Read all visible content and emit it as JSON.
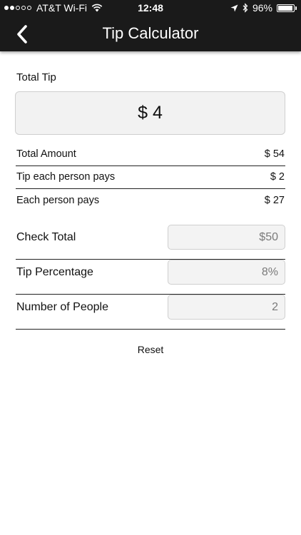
{
  "status_bar": {
    "carrier": "AT&T Wi-Fi",
    "time": "12:48",
    "battery": "96%",
    "battery_level": 0.96,
    "signal_bars_filled": 2,
    "signal_bars_total": 5
  },
  "nav": {
    "title": "Tip Calculator",
    "back_icon": "chevron-left-icon"
  },
  "total_tip": {
    "label": "Total Tip",
    "value": "$ 4"
  },
  "summary": [
    {
      "label": "Total Amount",
      "value": "$ 54"
    },
    {
      "label": "Tip each person pays",
      "value": "$ 2"
    },
    {
      "label": "Each person pays",
      "value": "$ 27"
    }
  ],
  "inputs": {
    "check_total": {
      "label": "Check Total",
      "value": "$50"
    },
    "tip_percentage": {
      "label": "Tip Percentage",
      "value": "8%"
    },
    "number_of_people": {
      "label": "Number of People",
      "value": "2"
    }
  },
  "reset_label": "Reset",
  "colors": {
    "nav_background": "#1a1a1a",
    "field_background": "#f3f3f3",
    "field_border": "#cfcfcf"
  }
}
